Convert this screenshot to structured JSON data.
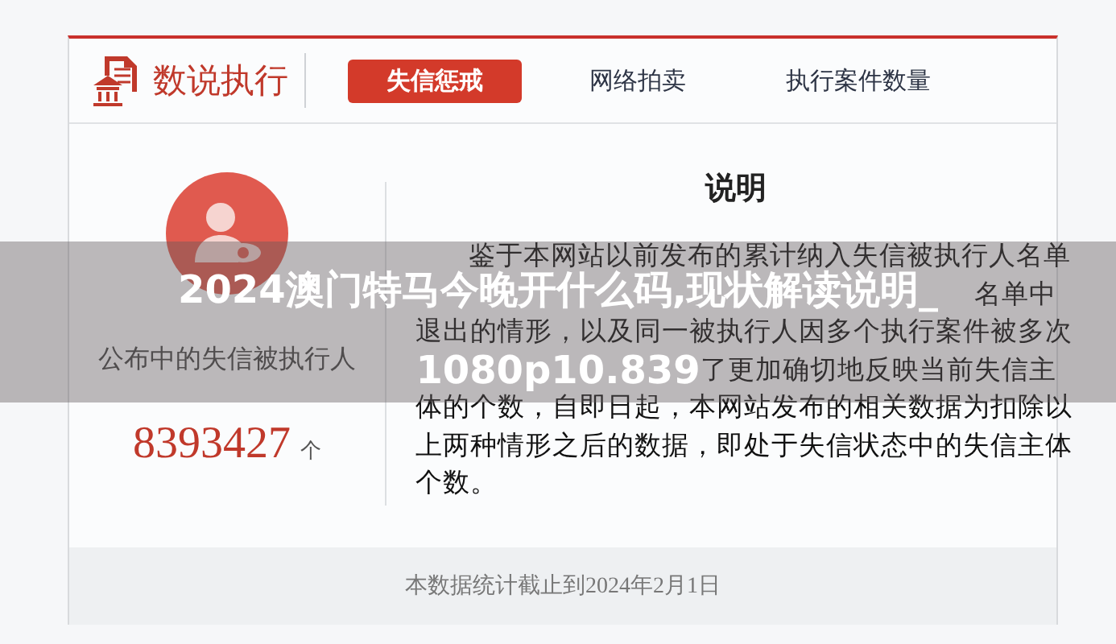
{
  "header": {
    "logo_text": "数说执行",
    "tabs": [
      {
        "label": "失信惩戒",
        "selected": true
      },
      {
        "label": "网络拍卖",
        "selected": false
      },
      {
        "label": "执行案件数量",
        "selected": false
      }
    ]
  },
  "summary": {
    "label": "公布中的失信被执行人",
    "count": "8393427",
    "unit": "个"
  },
  "explanation": {
    "title": "说明",
    "lines": [
      {
        "text": "鉴于本网站以前发布的累计纳入失信被执行人名单",
        "kind": "first"
      },
      {
        "text": "名单中",
        "kind": "tail"
      },
      {
        "text": "退出的情形，以及同一被执行人因多个执行案件被多次",
        "kind": "full"
      },
      {
        "text": "了更加确切地反映当前失信主",
        "kind": "tail"
      },
      {
        "text": "体的个数，自即日起，本网站发布的相关数据为扣除以",
        "kind": "full"
      },
      {
        "text": "上两种情形之后的数据，即处于失信状态中的失信主体",
        "kind": "full"
      },
      {
        "text": "个数。",
        "kind": "last"
      }
    ]
  },
  "footer": {
    "note": "本数据统计截止到2024年2月1日"
  },
  "overlay_title": {
    "lines": [
      "2024澳门特马今晚开什么码,现状解读说明_",
      "1080p10.839"
    ]
  }
}
